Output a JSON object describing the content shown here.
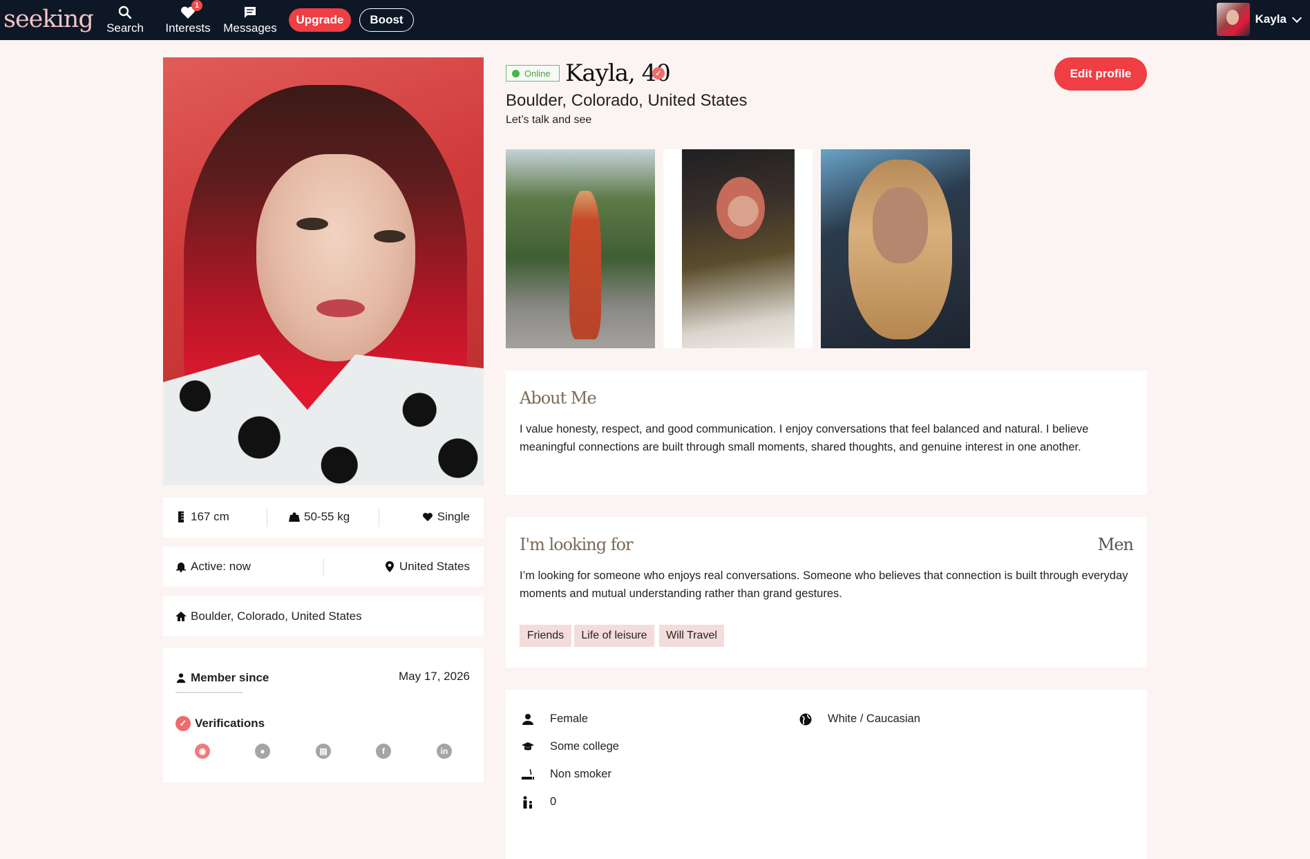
{
  "nav": {
    "logo": "seeking",
    "items": [
      {
        "label": "Search",
        "icon": "search-icon"
      },
      {
        "label": "Interests",
        "icon": "heart-icon",
        "badge": "1"
      },
      {
        "label": "Messages",
        "icon": "chat-icon"
      }
    ],
    "upgrade_label": "Upgrade",
    "boost_label": "Boost",
    "user_name": "Kayla"
  },
  "profile": {
    "online_label": "Online",
    "name_age": "Kayla, 40",
    "location": "Boulder, Colorado, United States",
    "tagline": "Let’s talk and see",
    "edit_label": "Edit profile"
  },
  "stats": {
    "height": "167 cm",
    "weight": "50-55 kg",
    "relationship": "Single",
    "active": "Active: now",
    "country": "United States",
    "home": "Boulder, Colorado, United States",
    "member_since_label": "Member since",
    "member_since_date": "May 17, 2026",
    "verifications_label": "Verifications"
  },
  "about": {
    "title": "About Me",
    "text": "I value honesty, respect, and good communication. I enjoy conversations that feel balanced and natural. I believe meaningful connections are built through small moments, shared thoughts, and genuine interest in one another."
  },
  "looking_for": {
    "title": "I'm looking for",
    "target": "Men",
    "text": "I’m looking for someone who enjoys real conversations. Someone who believes that connection is built through everyday moments and mutual understanding rather than grand gestures.",
    "tags": [
      "Friends",
      "Life of leisure",
      "Will Travel"
    ]
  },
  "details": {
    "gender": "Female",
    "education": "Some college",
    "smoking": "Non smoker",
    "children": "0",
    "ethnicity": "White / Caucasian"
  },
  "colors": {
    "nav_bg": "#0d1726",
    "accent": "#ef3e44",
    "page_bg": "#fcf4f2",
    "online": "#49b24c"
  }
}
